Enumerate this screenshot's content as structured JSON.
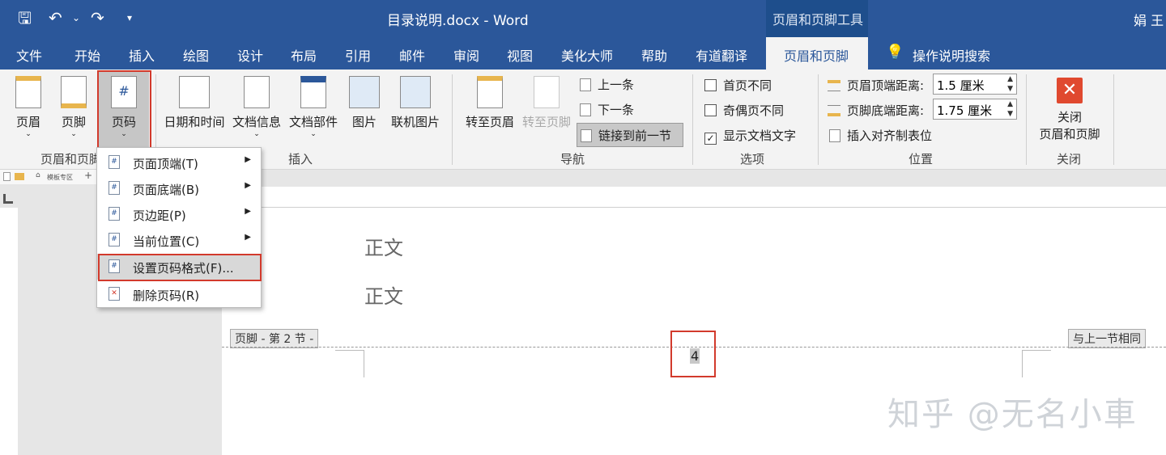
{
  "title_bar": {
    "save_icon": "save-icon",
    "undo_icon": "undo-icon",
    "redo_icon": "redo-icon",
    "customize_icon": "customize-qat-icon",
    "document_title": "目录说明.docx  -  Word",
    "context_tool_title": "页眉和页脚工具",
    "user": "娟 王"
  },
  "tabs": [
    "文件",
    "开始",
    "插入",
    "绘图",
    "设计",
    "布局",
    "引用",
    "邮件",
    "审阅",
    "视图",
    "美化大师",
    "帮助",
    "有道翻译",
    "页眉和页脚"
  ],
  "search_label": "操作说明搜索",
  "ribbon": {
    "header_footer_group": {
      "buttons": [
        "页眉",
        "页脚",
        "页码"
      ],
      "label": "页眉和页脚"
    },
    "insert_group": {
      "buttons": [
        "日期和时间",
        "文档信息",
        "文档部件",
        "图片",
        "联机图片"
      ],
      "label": "插入"
    },
    "navigation_group": {
      "goto_header": "转至页眉",
      "goto_footer": "转至页脚",
      "previous": "上一条",
      "next": "下一条",
      "link_previous": "链接到前一节",
      "label": "导航"
    },
    "options_group": {
      "first_page_different": "首页不同",
      "odd_even_different": "奇偶页不同",
      "show_document_text": "显示文档文字",
      "show_document_text_checked": true,
      "label": "选项"
    },
    "position_group": {
      "header_from_top_label": "页眉顶端距离:",
      "header_from_top_value": "1.5 厘米",
      "footer_from_bottom_label": "页脚底端距离:",
      "footer_from_bottom_value": "1.75 厘米",
      "insert_alignment_tab": "插入对齐制表位",
      "label": "位置"
    },
    "close_group": {
      "button_line1": "关闭",
      "button_line2": "页眉和页脚",
      "label": "关闭"
    }
  },
  "page_number_menu": [
    {
      "label": "页面顶端(T)",
      "submenu": true
    },
    {
      "label": "页面底端(B)",
      "submenu": true
    },
    {
      "label": "页边距(P)",
      "submenu": true
    },
    {
      "label": "当前位置(C)",
      "submenu": true
    },
    {
      "label": "设置页码格式(F)...",
      "submenu": false
    },
    {
      "label": "删除页码(R)",
      "submenu": false
    }
  ],
  "document": {
    "tab_label": "模板专区",
    "body_lines": [
      "正文",
      "正文"
    ],
    "footer_tag": "页脚 - 第 2 节 -",
    "same_as_previous_tag": "与上一节相同",
    "page_number": "4"
  },
  "watermark": "知乎 @无名小車"
}
